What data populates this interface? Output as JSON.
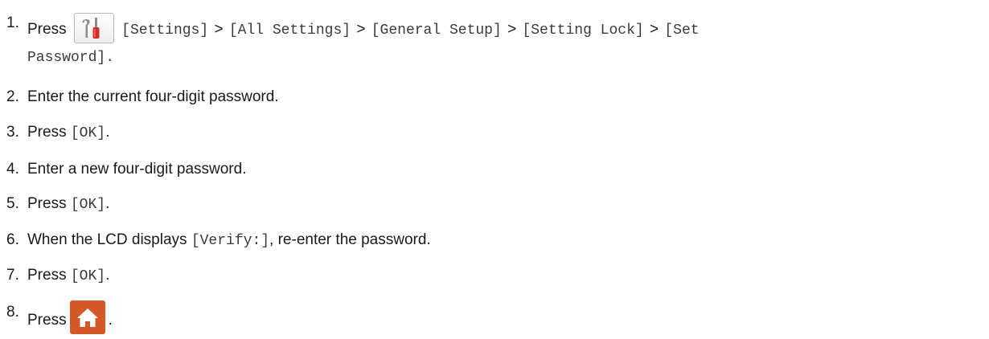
{
  "steps": [
    {
      "number": "1.",
      "press": "Press",
      "path": [
        "[Settings]",
        "[All Settings]",
        "[General Setup]",
        "[Setting Lock]",
        "[Set"
      ],
      "continuation": "Password].",
      "separator": ">",
      "icon": "settings-tools-icon"
    },
    {
      "number": "2.",
      "text": "Enter the current four-digit password."
    },
    {
      "number": "3.",
      "press": "Press",
      "code": "[OK]",
      "tail": "."
    },
    {
      "number": "4.",
      "text": "Enter a new four-digit password."
    },
    {
      "number": "5.",
      "press": "Press",
      "code": "[OK]",
      "tail": "."
    },
    {
      "number": "6.",
      "before": "When the LCD displays",
      "code": "[Verify:]",
      "after": ", re-enter the password."
    },
    {
      "number": "7.",
      "press": "Press",
      "code": "[OK]",
      "tail": "."
    },
    {
      "number": "8.",
      "press": "Press",
      "tail": ".",
      "icon": "home-icon"
    }
  ],
  "colors": {
    "text": "#1a1a1a",
    "code": "#3a3a3a",
    "home_button": "#d35a28",
    "settings_red": "#d42c2c"
  }
}
